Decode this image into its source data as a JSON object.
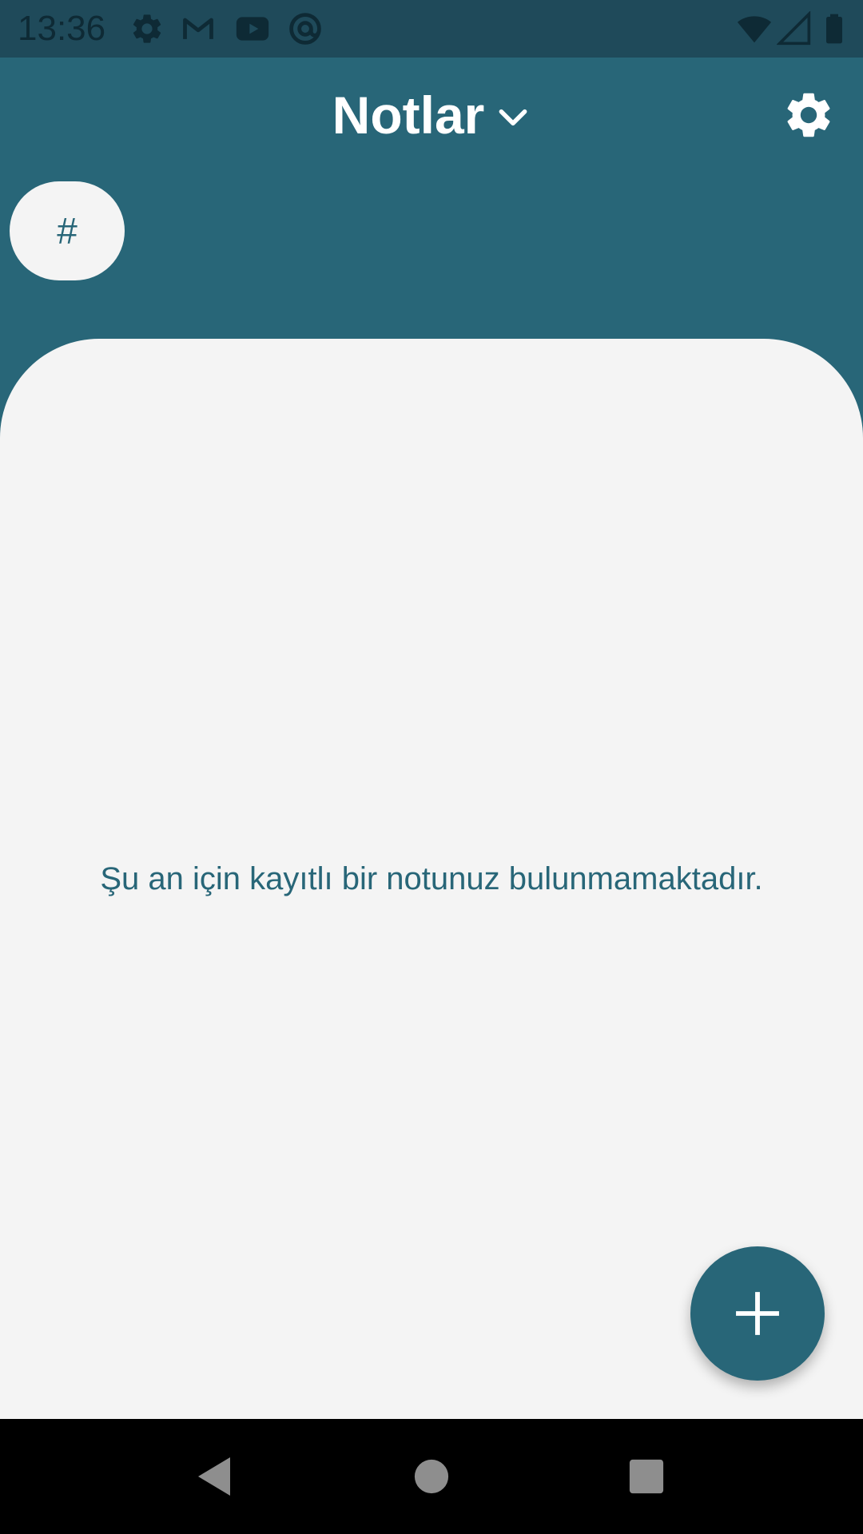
{
  "status_bar": {
    "time": "13:36",
    "icons": [
      "settings-icon",
      "gmail-icon",
      "youtube-icon",
      "at-sign-icon",
      "wifi-icon",
      "signal-icon",
      "battery-icon"
    ]
  },
  "app_bar": {
    "title": "Notlar",
    "title_dropdown_icon": "chevron-down-icon",
    "settings_icon": "gear-icon"
  },
  "tag_filter": {
    "label": "#"
  },
  "content": {
    "empty_message": "Şu an için kayıtlı bir notunuz bulunmamaktadır."
  },
  "fab": {
    "icon": "plus-icon"
  },
  "nav_bar": {
    "buttons": [
      "back-icon",
      "home-icon",
      "recents-icon"
    ]
  },
  "colors": {
    "primary": "#286678",
    "status_bar": "#1f4a5a",
    "surface": "#f4f4f4",
    "nav_bar": "#000000"
  }
}
